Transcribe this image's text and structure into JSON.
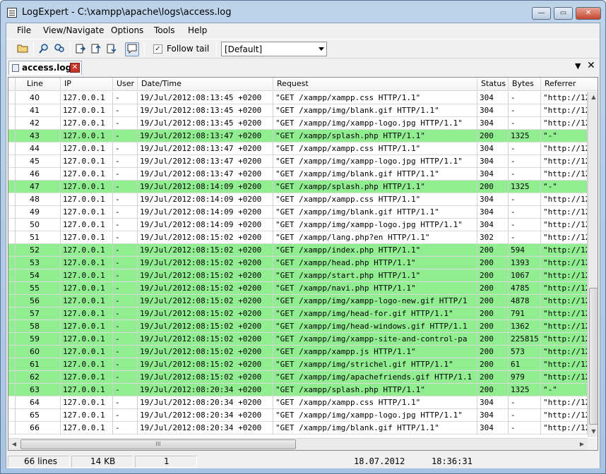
{
  "window": {
    "title": "LogExpert - C:\\xampp\\apache\\logs\\access.log",
    "minimize_glyph": "—",
    "maximize_glyph": "▭",
    "close_glyph": "✕"
  },
  "menu": {
    "items": [
      "File",
      "View/Navigate",
      "Options",
      "Tools",
      "Help"
    ]
  },
  "toolbar": {
    "icons": [
      "open-folder-icon",
      "search-icon",
      "filter-icon",
      "previous-bookmark-icon",
      "next-bookmark-icon",
      "bookmark-down-icon",
      "bubble-icon"
    ],
    "follow_tail_label": "Follow tail",
    "follow_tail_checked": "✓",
    "highlight_group": "[Default]"
  },
  "tabs": {
    "active": "access.log",
    "close_glyph": "✕",
    "menu_glyph": "▼",
    "panel_close_glyph": "✕"
  },
  "grid": {
    "columns": [
      "Line",
      "IP",
      "User",
      "Date/Time",
      "Request",
      "Status",
      "Bytes",
      "Referrer"
    ],
    "highlight_color": "#90ee90",
    "rows": [
      {
        "line": "40",
        "ip": "127.0.0.1",
        "user": "-",
        "datetime": "19/Jul/2012:08:13:45 +0200",
        "request": "\"GET /xampp/xampp.css HTTP/1.1\"",
        "status": "304",
        "bytes": "-",
        "referrer": "\"http://12",
        "hl": false
      },
      {
        "line": "41",
        "ip": "127.0.0.1",
        "user": "-",
        "datetime": "19/Jul/2012:08:13:45 +0200",
        "request": "\"GET /xampp/img/blank.gif HTTP/1.1\"",
        "status": "304",
        "bytes": "-",
        "referrer": "\"http://12",
        "hl": false
      },
      {
        "line": "42",
        "ip": "127.0.0.1",
        "user": "-",
        "datetime": "19/Jul/2012:08:13:45 +0200",
        "request": "\"GET /xampp/img/xampp-logo.jpg HTTP/1.1\"",
        "status": "304",
        "bytes": "-",
        "referrer": "\"http://12",
        "hl": false
      },
      {
        "line": "43",
        "ip": "127.0.0.1",
        "user": "-",
        "datetime": "19/Jul/2012:08:13:47 +0200",
        "request": "\"GET /xampp/splash.php HTTP/1.1\"",
        "status": "200",
        "bytes": "1325",
        "referrer": "\"-\"",
        "hl": true
      },
      {
        "line": "44",
        "ip": "127.0.0.1",
        "user": "-",
        "datetime": "19/Jul/2012:08:13:47 +0200",
        "request": "\"GET /xampp/xampp.css HTTP/1.1\"",
        "status": "304",
        "bytes": "-",
        "referrer": "\"http://12",
        "hl": false
      },
      {
        "line": "45",
        "ip": "127.0.0.1",
        "user": "-",
        "datetime": "19/Jul/2012:08:13:47 +0200",
        "request": "\"GET /xampp/img/xampp-logo.jpg HTTP/1.1\"",
        "status": "304",
        "bytes": "-",
        "referrer": "\"http://12",
        "hl": false
      },
      {
        "line": "46",
        "ip": "127.0.0.1",
        "user": "-",
        "datetime": "19/Jul/2012:08:13:47 +0200",
        "request": "\"GET /xampp/img/blank.gif HTTP/1.1\"",
        "status": "304",
        "bytes": "-",
        "referrer": "\"http://12",
        "hl": false
      },
      {
        "line": "47",
        "ip": "127.0.0.1",
        "user": "-",
        "datetime": "19/Jul/2012:08:14:09 +0200",
        "request": "\"GET /xampp/splash.php HTTP/1.1\"",
        "status": "200",
        "bytes": "1325",
        "referrer": "\"-\"",
        "hl": true
      },
      {
        "line": "48",
        "ip": "127.0.0.1",
        "user": "-",
        "datetime": "19/Jul/2012:08:14:09 +0200",
        "request": "\"GET /xampp/xampp.css HTTP/1.1\"",
        "status": "304",
        "bytes": "-",
        "referrer": "\"http://12",
        "hl": false
      },
      {
        "line": "49",
        "ip": "127.0.0.1",
        "user": "-",
        "datetime": "19/Jul/2012:08:14:09 +0200",
        "request": "\"GET /xampp/img/blank.gif HTTP/1.1\"",
        "status": "304",
        "bytes": "-",
        "referrer": "\"http://12",
        "hl": false
      },
      {
        "line": "50",
        "ip": "127.0.0.1",
        "user": "-",
        "datetime": "19/Jul/2012:08:14:09 +0200",
        "request": "\"GET /xampp/img/xampp-logo.jpg HTTP/1.1\"",
        "status": "304",
        "bytes": "-",
        "referrer": "\"http://12",
        "hl": false
      },
      {
        "line": "51",
        "ip": "127.0.0.1",
        "user": "-",
        "datetime": "19/Jul/2012:08:15:02 +0200",
        "request": "\"GET /xampp/lang.php?en HTTP/1.1\"",
        "status": "302",
        "bytes": "-",
        "referrer": "\"http://12",
        "hl": false
      },
      {
        "line": "52",
        "ip": "127.0.0.1",
        "user": "-",
        "datetime": "19/Jul/2012:08:15:02 +0200",
        "request": "\"GET /xampp/index.php HTTP/1.1\"",
        "status": "200",
        "bytes": "594",
        "referrer": "\"http://12",
        "hl": true
      },
      {
        "line": "53",
        "ip": "127.0.0.1",
        "user": "-",
        "datetime": "19/Jul/2012:08:15:02 +0200",
        "request": "\"GET /xampp/head.php HTTP/1.1\"",
        "status": "200",
        "bytes": "1393",
        "referrer": "\"http://12",
        "hl": true
      },
      {
        "line": "54",
        "ip": "127.0.0.1",
        "user": "-",
        "datetime": "19/Jul/2012:08:15:02 +0200",
        "request": "\"GET /xampp/start.php HTTP/1.1\"",
        "status": "200",
        "bytes": "1067",
        "referrer": "\"http://12",
        "hl": true
      },
      {
        "line": "55",
        "ip": "127.0.0.1",
        "user": "-",
        "datetime": "19/Jul/2012:08:15:02 +0200",
        "request": "\"GET /xampp/navi.php HTTP/1.1\"",
        "status": "200",
        "bytes": "4785",
        "referrer": "\"http://12",
        "hl": true
      },
      {
        "line": "56",
        "ip": "127.0.0.1",
        "user": "-",
        "datetime": "19/Jul/2012:08:15:02 +0200",
        "request": "\"GET /xampp/img/xampp-logo-new.gif HTTP/1",
        "status": "200",
        "bytes": "4878",
        "referrer": "\"http://12",
        "hl": true
      },
      {
        "line": "57",
        "ip": "127.0.0.1",
        "user": "-",
        "datetime": "19/Jul/2012:08:15:02 +0200",
        "request": "\"GET /xampp/img/head-for.gif HTTP/1.1\"",
        "status": "200",
        "bytes": "791",
        "referrer": "\"http://12",
        "hl": true
      },
      {
        "line": "58",
        "ip": "127.0.0.1",
        "user": "-",
        "datetime": "19/Jul/2012:08:15:02 +0200",
        "request": "\"GET /xampp/img/head-windows.gif HTTP/1.1",
        "status": "200",
        "bytes": "1362",
        "referrer": "\"http://12",
        "hl": true
      },
      {
        "line": "59",
        "ip": "127.0.0.1",
        "user": "-",
        "datetime": "19/Jul/2012:08:15:02 +0200",
        "request": "\"GET /xampp/img/xampp-site-and-control-pa",
        "status": "200",
        "bytes": "225815",
        "referrer": "\"http://12",
        "hl": true
      },
      {
        "line": "60",
        "ip": "127.0.0.1",
        "user": "-",
        "datetime": "19/Jul/2012:08:15:02 +0200",
        "request": "\"GET /xampp/xampp.js HTTP/1.1\"",
        "status": "200",
        "bytes": "573",
        "referrer": "\"http://12",
        "hl": true
      },
      {
        "line": "61",
        "ip": "127.0.0.1",
        "user": "-",
        "datetime": "19/Jul/2012:08:15:02 +0200",
        "request": "\"GET /xampp/img/strichel.gif HTTP/1.1\"",
        "status": "200",
        "bytes": "61",
        "referrer": "\"http://12",
        "hl": true
      },
      {
        "line": "62",
        "ip": "127.0.0.1",
        "user": "-",
        "datetime": "19/Jul/2012:08:15:02 +0200",
        "request": "\"GET /xampp/img/apachefriends.gif HTTP/1.1",
        "status": "200",
        "bytes": "979",
        "referrer": "\"http://12",
        "hl": true
      },
      {
        "line": "63",
        "ip": "127.0.0.1",
        "user": "-",
        "datetime": "19/Jul/2012:08:20:34 +0200",
        "request": "\"GET /xampp/splash.php HTTP/1.1\"",
        "status": "200",
        "bytes": "1325",
        "referrer": "\"-\"",
        "hl": true
      },
      {
        "line": "64",
        "ip": "127.0.0.1",
        "user": "-",
        "datetime": "19/Jul/2012:08:20:34 +0200",
        "request": "\"GET /xampp/xampp.css HTTP/1.1\"",
        "status": "304",
        "bytes": "-",
        "referrer": "\"http://12",
        "hl": false
      },
      {
        "line": "65",
        "ip": "127.0.0.1",
        "user": "-",
        "datetime": "19/Jul/2012:08:20:34 +0200",
        "request": "\"GET /xampp/img/xampp-logo.jpg HTTP/1.1\"",
        "status": "304",
        "bytes": "-",
        "referrer": "\"http://12",
        "hl": false
      },
      {
        "line": "66",
        "ip": "127.0.0.1",
        "user": "-",
        "datetime": "19/Jul/2012:08:20:34 +0200",
        "request": "\"GET /xampp/img/blank.gif HTTP/1.1\"",
        "status": "304",
        "bytes": "-",
        "referrer": "\"http://12",
        "hl": false
      }
    ]
  },
  "scroll": {
    "up_glyph": "▲",
    "down_glyph": "▼",
    "left_glyph": "◀",
    "right_glyph": "▶",
    "grip_glyph": "III"
  },
  "status": {
    "lines": "66 lines",
    "size": "14 KB",
    "position": "1",
    "date": "18.07.2012",
    "time": "18:36:31"
  }
}
